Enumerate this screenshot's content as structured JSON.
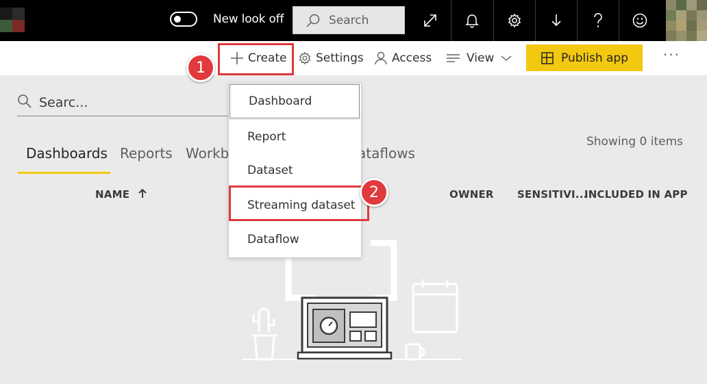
{
  "topbar": {
    "toggle_label": "New look off",
    "search_placeholder": "Search",
    "icons": [
      "expand-icon",
      "bell-icon",
      "gear-icon",
      "download-icon",
      "help-icon",
      "smiley-icon"
    ]
  },
  "commandbar": {
    "create": "Create",
    "settings": "Settings",
    "access": "Access",
    "view": "View",
    "publish": "Publish app",
    "more": "···"
  },
  "main": {
    "search_placeholder": "Searc...",
    "showing": "Showing 0 items",
    "tabs": [
      "Dashboards",
      "Reports",
      "Workb",
      "ataflows"
    ],
    "columns": {
      "name": "NAME",
      "owner": "OWNER",
      "sensitivity": "SENSITIVI...",
      "included": "INCLUDED IN APP"
    }
  },
  "dropdown": {
    "items": [
      "Dashboard",
      "Report",
      "Dataset",
      "Streaming dataset",
      "Dataflow"
    ]
  },
  "callouts": {
    "one": "1",
    "two": "2"
  },
  "colors": {
    "accent": "#f2c811",
    "callout": "#e0393e",
    "topbar": "#000000"
  }
}
